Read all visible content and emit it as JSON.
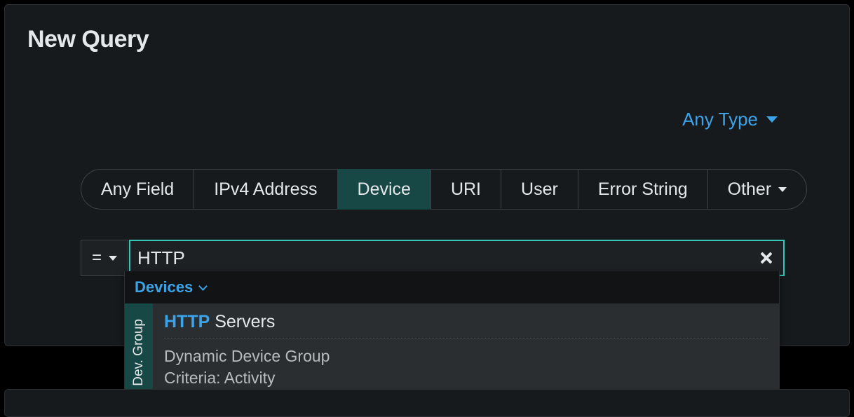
{
  "panel": {
    "title": "New Query",
    "type_filter": {
      "label": "Any Type"
    },
    "fields": [
      {
        "label": "Any Field",
        "active": false
      },
      {
        "label": "IPv4 Address",
        "active": false
      },
      {
        "label": "Device",
        "active": true
      },
      {
        "label": "URI",
        "active": false
      },
      {
        "label": "User",
        "active": false
      },
      {
        "label": "Error String",
        "active": false
      },
      {
        "label": "Other",
        "active": false,
        "has_menu": true
      }
    ],
    "operator": "=",
    "search_value": "HTTP"
  },
  "suggest": {
    "section_label": "Devices",
    "item": {
      "badge": "Dev. Group",
      "match": "HTTP",
      "rest": " Servers",
      "line1": "Dynamic Device Group",
      "line2": "Criteria: Activity"
    }
  }
}
